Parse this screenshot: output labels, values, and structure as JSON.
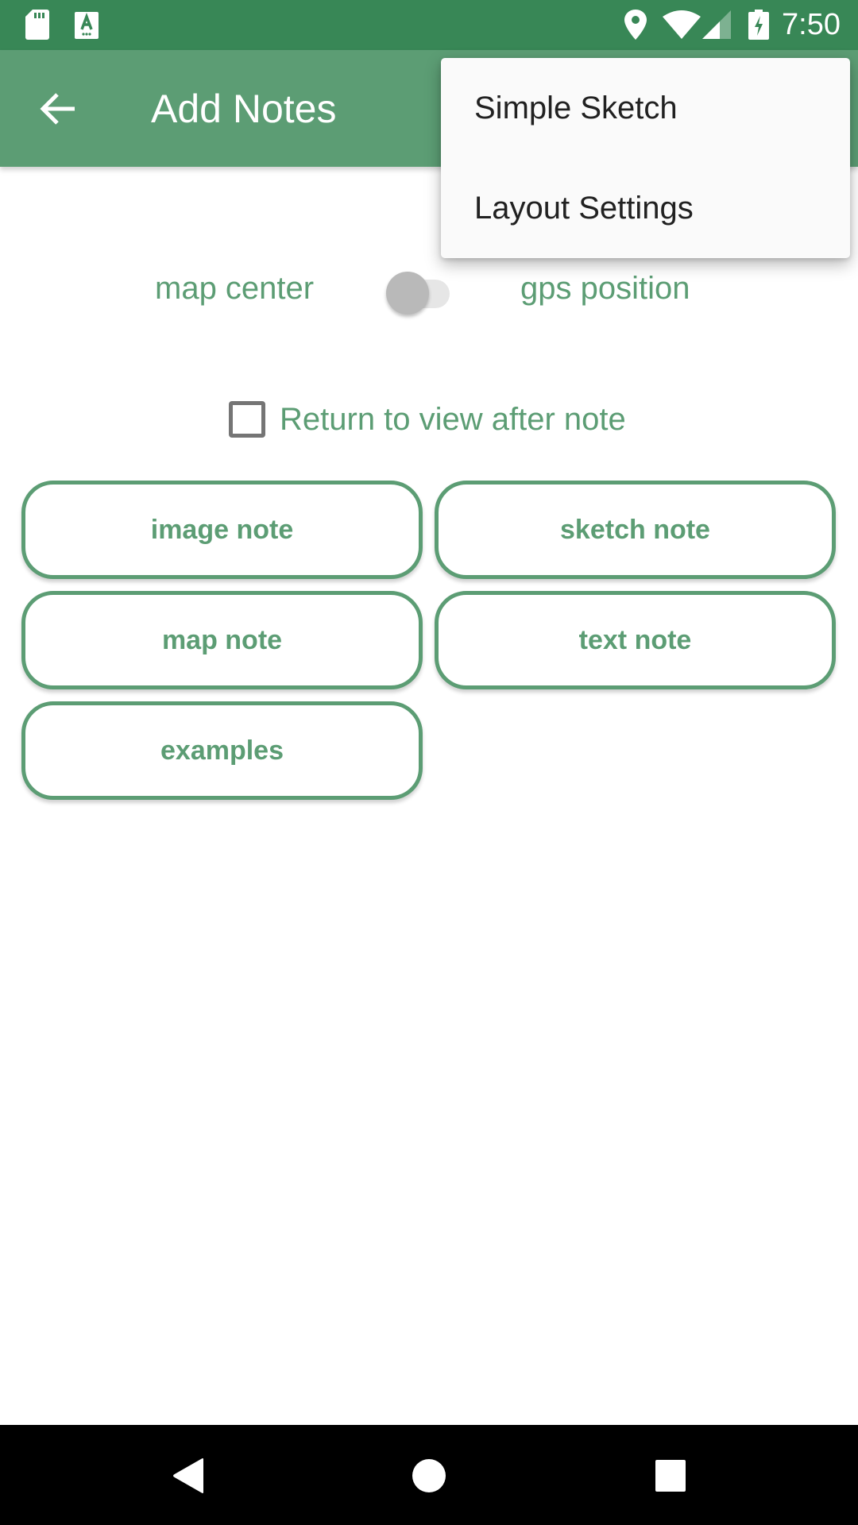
{
  "status_bar": {
    "time": "7:50",
    "icons": [
      "sd-card-icon",
      "accessibility-a-icon",
      "location-icon",
      "wifi-icon",
      "cell-signal-icon",
      "battery-charging-icon"
    ]
  },
  "app_bar": {
    "title": "Add Notes",
    "back_icon": "arrow-back-icon"
  },
  "position_toggle": {
    "left_label": "map center",
    "right_label": "gps position",
    "checked": false
  },
  "return_checkbox": {
    "label": "Return to view after note",
    "checked": false
  },
  "buttons": [
    {
      "label": "image note"
    },
    {
      "label": "sketch note"
    },
    {
      "label": "map note"
    },
    {
      "label": "text note"
    },
    {
      "label": "examples"
    }
  ],
  "overflow_menu": {
    "items": [
      {
        "label": "Simple Sketch"
      },
      {
        "label": "Layout Settings"
      }
    ]
  },
  "nav_bar": {
    "icons": [
      "nav-back-icon",
      "nav-home-icon",
      "nav-recents-icon"
    ]
  },
  "colors": {
    "status_bar": "#388756",
    "app_bar": "#5c9d74",
    "accent": "#5c9d74",
    "menu_bg": "#fafafa",
    "menu_text": "#212121"
  }
}
